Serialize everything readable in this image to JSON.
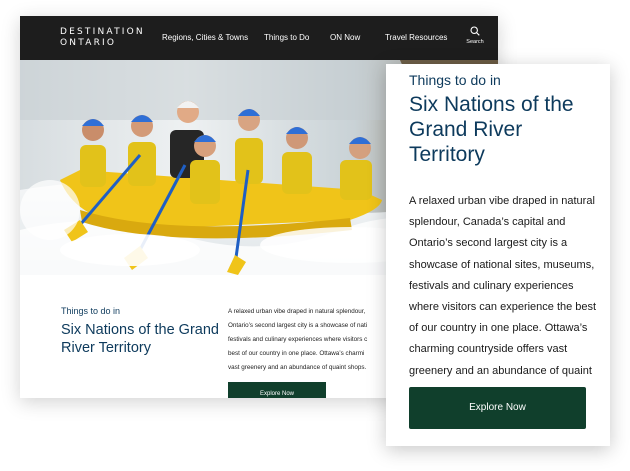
{
  "desktop": {
    "nav": {
      "logo_line1": "DESTINATION",
      "logo_line2": "ONTARIO",
      "items": [
        "Regions, Cities & Towns",
        "Things to Do",
        "ON Now",
        "Travel Resources"
      ],
      "search_label": "Search",
      "search_icon": "search-icon"
    },
    "hero_image": "whitewater-rafting-photo",
    "eyebrow": "Things to do in",
    "title": "Six Nations of the Grand River Territory",
    "body": "A relaxed urban vibe draped in natural splendour,\nOntario’s second largest city is a showcase of nati\nfestivals and culinary experiences where visitors c\nbest of our country in one place. Ottawa’s charmi\nvast greenery and an abundance of quaint shops.",
    "button_label": "Explore Now"
  },
  "mobile": {
    "eyebrow": "Things to do in",
    "title": "Six Nations of the Grand River Territory",
    "body": "A relaxed urban vibe draped in natural splendour, Canada’s capital and Ontario’s second largest city is a showcase of national sites, museums, festivals and culinary experiences where visitors can experience the best of our country in one place. Ottawa’s charming countryside offers vast greenery and an abundance of quaint shops.",
    "button_label": "Explore Now"
  },
  "colors": {
    "nav_bg": "#1d1d1d",
    "heading": "#0d3a5c",
    "button": "#103f2c"
  }
}
